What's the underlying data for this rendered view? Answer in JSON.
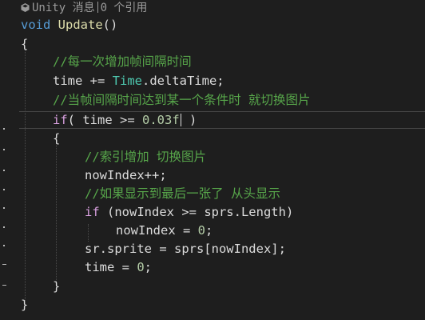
{
  "codelens": {
    "label": "Unity 消息",
    "refs": "0 个引用",
    "icon": "unity-cube-icon"
  },
  "lines": {
    "l1": {
      "kw": "void",
      "name": "Update",
      "paren": "()"
    },
    "l2": "{",
    "l3": "//每一次增加帧间隔时间",
    "l4": {
      "a": "time += ",
      "type": "Time",
      "b": ".deltaTime;"
    },
    "l5": "//当帧间隔时间达到某一个条件时 就切换图片",
    "l6": {
      "kw": "if",
      "a": "( time >= ",
      "num": "0.03f",
      "b": " )"
    },
    "l7": "{",
    "l8": "//索引增加 切换图片",
    "l9": "nowIndex++;",
    "l10": "//如果显示到最后一张了 从头显示",
    "l11": {
      "kw": "if",
      "a": " (nowIndex >= sprs.Length)"
    },
    "l12": {
      "a": "nowIndex = ",
      "num": "0",
      "b": ";"
    },
    "l13": "sr.sprite = sprs[nowIndex];",
    "l14": {
      "a": "time = ",
      "num": "0",
      "b": ";"
    },
    "l15": "}",
    "l16": "}"
  }
}
